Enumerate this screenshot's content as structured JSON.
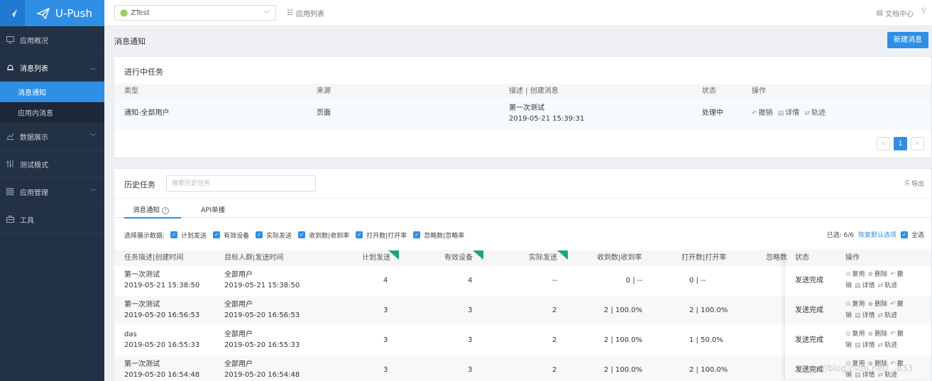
{
  "brand": {
    "name": "U-Push"
  },
  "sidebar": {
    "items": [
      {
        "label": "应用概况",
        "icon": "monitor-icon"
      },
      {
        "label": "消息列表",
        "icon": "bell-icon"
      },
      {
        "label": "数据展示",
        "icon": "chart-icon"
      },
      {
        "label": "测试模式",
        "icon": "sliders-icon"
      },
      {
        "label": "应用管理",
        "icon": "grid-icon"
      },
      {
        "label": "工具",
        "icon": "toolbox-icon"
      }
    ],
    "sub_items": [
      "消息通知",
      "应用内消息"
    ]
  },
  "topbar": {
    "app_select_value": "ZTest",
    "app_list_label": "应用列表",
    "doc_center_label": "文档中心"
  },
  "page": {
    "title": "消息通知",
    "new_message_button": "新建消息"
  },
  "active_tasks": {
    "title": "进行中任务",
    "columns": [
      "类型",
      "来源",
      "描述 | 创建消息",
      "状态",
      "操作"
    ],
    "row": {
      "type": "通知-全部用户",
      "source": "页面",
      "desc": "第一次测试",
      "time": "2019-05-21 15:39:31",
      "status": "处理中",
      "actions": [
        "撤销",
        "详情",
        "轨迹"
      ]
    },
    "pager": {
      "prev": "‹",
      "current": "1",
      "next": "›"
    }
  },
  "history": {
    "title": "历史任务",
    "search_placeholder": "搜索历史任务",
    "export_label": "导出",
    "tabs": [
      "消息通知",
      "API单播"
    ],
    "filter_label": "选择展示数据:",
    "filters": [
      "计划发送",
      "有效设备",
      "实际发送",
      "收到数|收到率",
      "打开数|打开率",
      "忽略数|忽略率"
    ],
    "selected_text": "已选: 6/6",
    "restore_label": "恢复默认选项",
    "select_all_label": "全选",
    "columns": [
      "任务描述|创建时间",
      "目标人群|发送时间",
      "计划发送",
      "有效设备",
      "实际发送",
      "收到数|收到率",
      "打开数|打开率",
      "忽略数",
      "状态",
      "操作"
    ],
    "rows": [
      {
        "desc": "第一次测试",
        "created": "2019-05-21 15:38:50",
        "target": "全部用户",
        "sent_time": "2019-05-21 15:38:50",
        "plan": "4",
        "valid": "4",
        "actual": "--",
        "recv": "0 | --",
        "open": "0 | --",
        "status": "发送完成"
      },
      {
        "desc": "第一次测试",
        "created": "2019-05-20 16:56:53",
        "target": "全部用户",
        "sent_time": "2019-05-20 16:56:53",
        "plan": "3",
        "valid": "3",
        "actual": "2",
        "recv": "2 | 100.0%",
        "open": "2 | 100.0%",
        "status": "发送完成"
      },
      {
        "desc": "das",
        "created": "2019-05-20 16:55:33",
        "target": "全部用户",
        "sent_time": "2019-05-20 16:55:33",
        "plan": "3",
        "valid": "3",
        "actual": "2",
        "recv": "2 | 100.0%",
        "open": "1 | 50.0%",
        "status": "发送完成"
      },
      {
        "desc": "第一次测试",
        "created": "2019-05-20 16:54:48",
        "target": "全部用户",
        "sent_time": "2019-05-20 16:54:48",
        "plan": "3",
        "valid": "3",
        "actual": "2",
        "recv": "2 | 100.0%",
        "open": "2 | 100.0%",
        "status": "发送完成"
      }
    ],
    "row_actions": {
      "reuse": "复用",
      "delete": "删除",
      "undo_a": "撤",
      "undo_b": "销",
      "detail": "详情",
      "track": "轨迹"
    }
  },
  "watermark": "https://blog.csdn.net/...833",
  "colors": {
    "accent": "#2e8fe5",
    "sidebar_bg": "#233144",
    "flag_green": "#1aa86b"
  }
}
